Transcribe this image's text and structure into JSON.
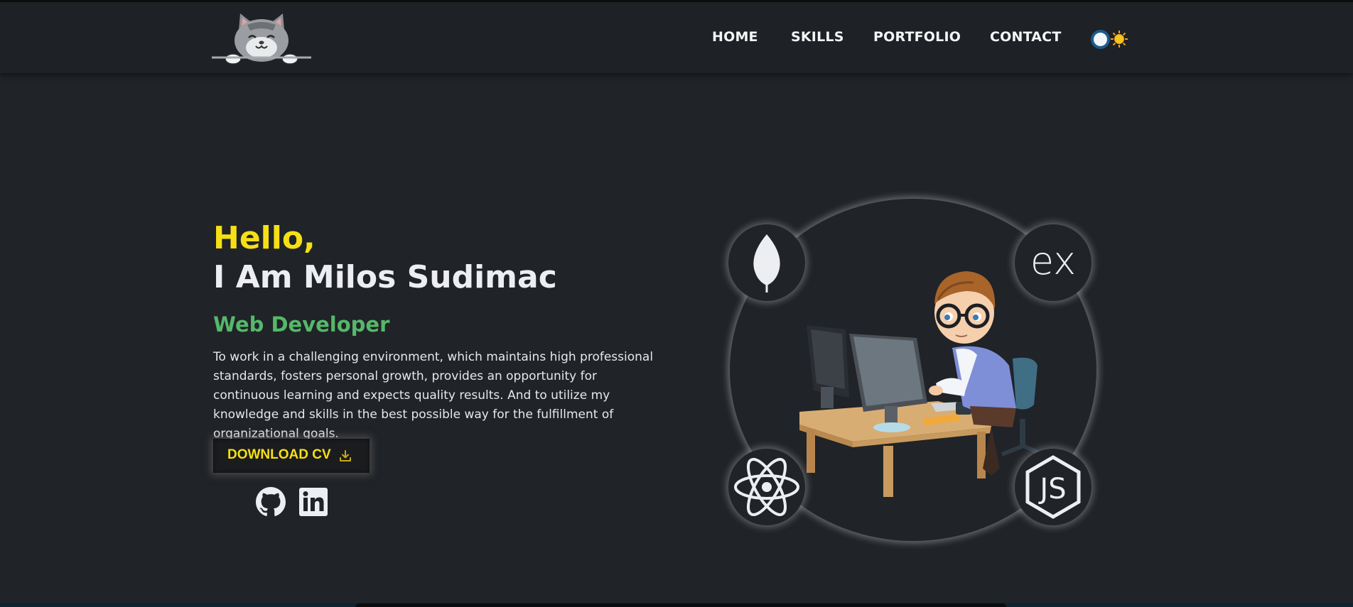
{
  "brand": {
    "logo_icon": "cat-peeking-logo"
  },
  "nav": {
    "items": [
      {
        "label": "HOME"
      },
      {
        "label": "SKILLS"
      },
      {
        "label": "PORTFOLIO"
      },
      {
        "label": "CONTACT"
      }
    ],
    "theme_toggle": {
      "state": "dark",
      "icon": "sun-icon"
    }
  },
  "hero": {
    "greeting": "Hello,",
    "name": "I Am Milos Sudimac",
    "role": "Web Developer",
    "objective": "To work in a challenging environment, which maintains high professional standards, fosters personal growth, provides an opportunity for continuous learning and expects quality results. And to utilize my knowledge and skills in the best possible way for the fulfillment of organizational goals.",
    "cv_button": {
      "label": "DOWNLOAD CV",
      "icon": "download-icon"
    },
    "social": [
      {
        "icon": "github-icon"
      },
      {
        "icon": "linkedin-icon"
      }
    ]
  },
  "illustration": {
    "badges": [
      {
        "icon": "mongodb-leaf-icon"
      },
      {
        "icon": "express-icon",
        "text": "ex"
      },
      {
        "icon": "react-icon"
      },
      {
        "icon": "nodejs-icon",
        "text": "JS"
      }
    ],
    "image": "developer-at-computer-illustration"
  },
  "colors": {
    "background": "#202327",
    "navbar": "#1e2125",
    "accent_yellow": "#f6df15",
    "accent_green": "#55b86a",
    "text": "#eceef1"
  }
}
